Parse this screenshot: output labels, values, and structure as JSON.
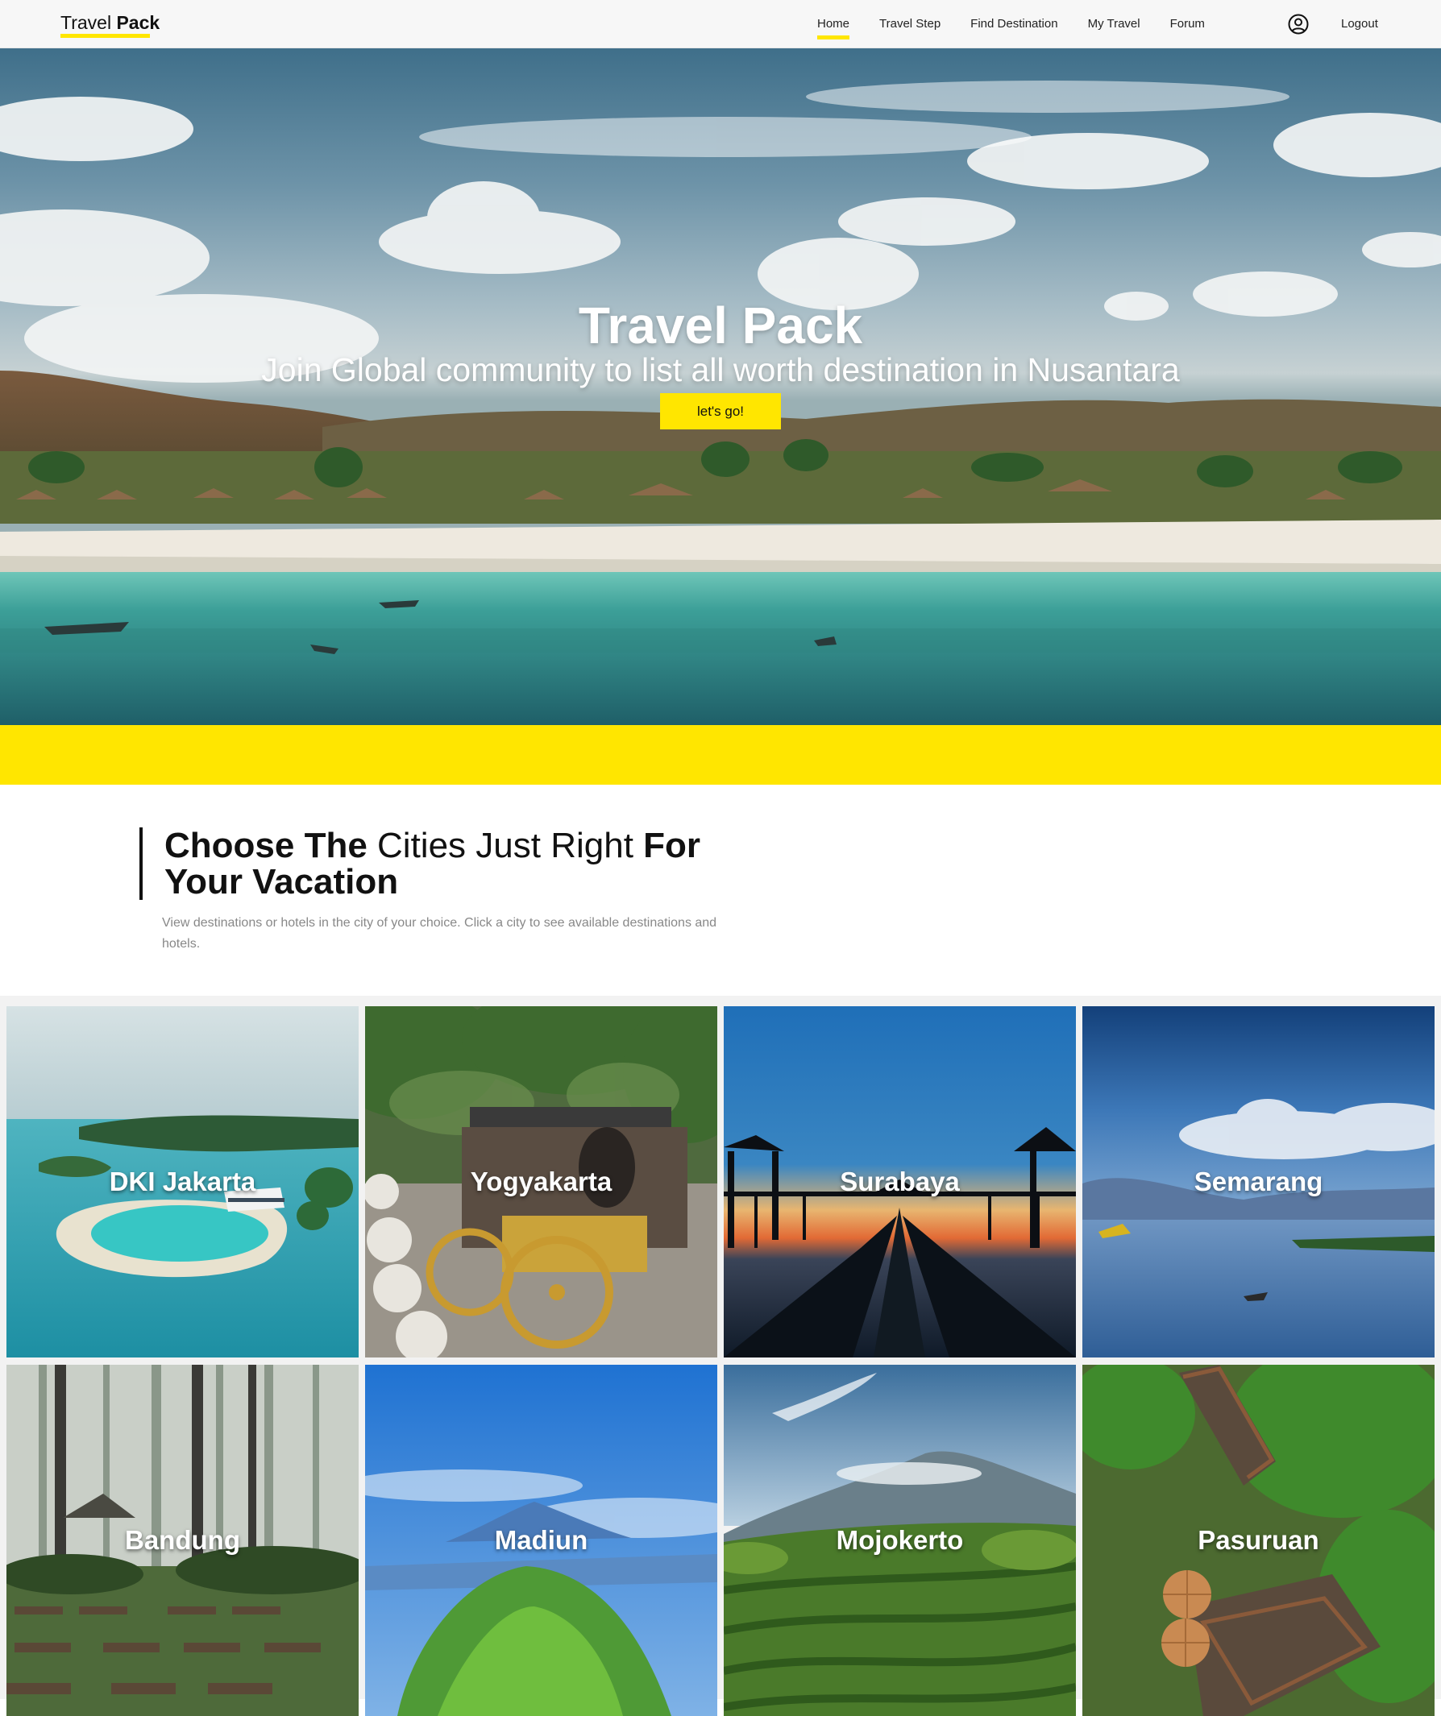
{
  "brand": {
    "light": "Travel",
    "bold": "Pack"
  },
  "nav": {
    "links": [
      "Home",
      "Travel Step",
      "Find Destination",
      "My Travel",
      "Forum"
    ],
    "logout": "Logout"
  },
  "hero": {
    "title": "Travel Pack",
    "subtitle": "Join Global community to list all worth destination in Nusantara",
    "button": "let's go!"
  },
  "section": {
    "heading_bold_1": "Choose The",
    "heading_light": "Cities Just Right",
    "heading_bold_2": "For Your Vacation",
    "description": "View destinations or hotels in the city of your choice. Click a city to see available destinations and hotels."
  },
  "cities": [
    "DKI Jakarta",
    "Yogyakarta",
    "Surabaya",
    "Semarang",
    "Bandung",
    "Madiun",
    "Mojokerto",
    "Pasuruan"
  ],
  "colors": {
    "accent": "#ffe600",
    "text": "#111111"
  },
  "icons": {
    "user": "user-circle-icon"
  }
}
